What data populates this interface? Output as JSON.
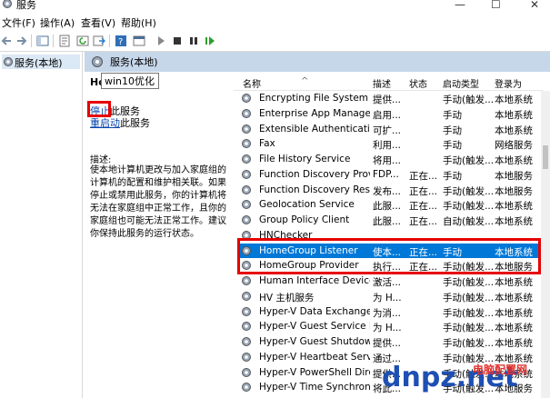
{
  "window": {
    "title": "服务"
  },
  "menu": {
    "items": [
      "文件(F)",
      "操作(A)",
      "查看(V)",
      "帮助(H)"
    ]
  },
  "toolbar": {
    "icons": [
      "back-icon",
      "forward-icon",
      "show-hide-tree-icon",
      "properties-icon",
      "refresh-icon",
      "export-icon",
      "help-icon",
      "console-icon",
      "start-icon",
      "stop-icon",
      "pause-icon",
      "restart-icon"
    ]
  },
  "left": {
    "node_label": "服务(本地)"
  },
  "header": {
    "title": "服务(本地)"
  },
  "desc": {
    "service_name": "Ho        ener",
    "tooltip": "win10优化",
    "stop_link": "停止",
    "stop_suffix": "此服务",
    "restart_link": "重启动",
    "restart_suffix": "此服务",
    "desc_title": "描述:",
    "desc_body": "使本地计算机更改与加入家庭组的计算机的配置和维护相关联。如果停止或禁用此服务，你的计算机将无法在家庭组中正常工作，且你的家庭组也可能无法正常工作。建议你保持此服务的运行状态。"
  },
  "columns": {
    "name": "名称",
    "desc": "描述",
    "status": "状态",
    "startup": "启动类型",
    "logon": "登录为"
  },
  "services": [
    {
      "name": "Encrypting File System (E...",
      "desc": "提供...",
      "status": "",
      "startup": "手动(触发...",
      "logon": "本地系统"
    },
    {
      "name": "Enterprise App Manage...",
      "desc": "启用...",
      "status": "",
      "startup": "手动",
      "logon": "本地系统"
    },
    {
      "name": "Extensible Authenticatio...",
      "desc": "可扩...",
      "status": "",
      "startup": "手动",
      "logon": "本地系统"
    },
    {
      "name": "Fax",
      "desc": "利用...",
      "status": "",
      "startup": "手动",
      "logon": "网络服务"
    },
    {
      "name": "File History Service",
      "desc": "将用...",
      "status": "",
      "startup": "手动(触发...",
      "logon": "本地系统"
    },
    {
      "name": "Function Discovery Provi...",
      "desc": "FDP...",
      "status": "正在...",
      "startup": "手动",
      "logon": "本地服务"
    },
    {
      "name": "Function Discovery Reso...",
      "desc": "发布...",
      "status": "正在...",
      "startup": "手动(触发...",
      "logon": "本地服务"
    },
    {
      "name": "Geolocation Service",
      "desc": "此服...",
      "status": "正在...",
      "startup": "手动(触发...",
      "logon": "本地系统"
    },
    {
      "name": "Group Policy Client",
      "desc": "此服...",
      "status": "正在...",
      "startup": "自动(触发...",
      "logon": "本地系统"
    },
    {
      "name": "HNChecker",
      "desc": "",
      "status": "",
      "startup": "",
      "logon": ""
    },
    {
      "name": "HomeGroup Listener",
      "desc": "使本...",
      "status": "正在...",
      "startup": "手动",
      "logon": "本地系统"
    },
    {
      "name": "HomeGroup Provider",
      "desc": "执行...",
      "status": "正在...",
      "startup": "手动(触发...",
      "logon": "本地服务"
    },
    {
      "name": "Human Interface Device ...",
      "desc": "激活...",
      "status": "",
      "startup": "手动(触发...",
      "logon": "本地系统"
    },
    {
      "name": "HV 主机服务",
      "desc": "为 H...",
      "status": "",
      "startup": "手动(触发...",
      "logon": "本地系统"
    },
    {
      "name": "Hyper-V Data Exchange ...",
      "desc": "为消...",
      "status": "",
      "startup": "手动(触发...",
      "logon": "本地系统"
    },
    {
      "name": "Hyper-V Guest Service In...",
      "desc": "为 H...",
      "status": "",
      "startup": "手动(触发...",
      "logon": "本地系统"
    },
    {
      "name": "Hyper-V Guest Shutdown...",
      "desc": "提供...",
      "status": "",
      "startup": "手动(触发...",
      "logon": "本地系统"
    },
    {
      "name": "Hyper-V Heartbeat Service",
      "desc": "通过...",
      "status": "",
      "startup": "手动(触发...",
      "logon": "本地系统"
    },
    {
      "name": "Hyper-V PowerShell Dire...",
      "desc": "提供...",
      "status": "",
      "startup": "手动(触发...",
      "logon": "本地系统"
    },
    {
      "name": "Hyper-V Time Synchroniz...",
      "desc": "将此...",
      "status": "",
      "startup": "手动(触发...",
      "logon": "本地服务"
    }
  ],
  "watermark": {
    "text": "电脑配置网",
    "brand": "dnpz.net"
  },
  "colors": {
    "selected": "#0078d7",
    "highlight": "#e60000",
    "header": "#c7d7ea"
  }
}
